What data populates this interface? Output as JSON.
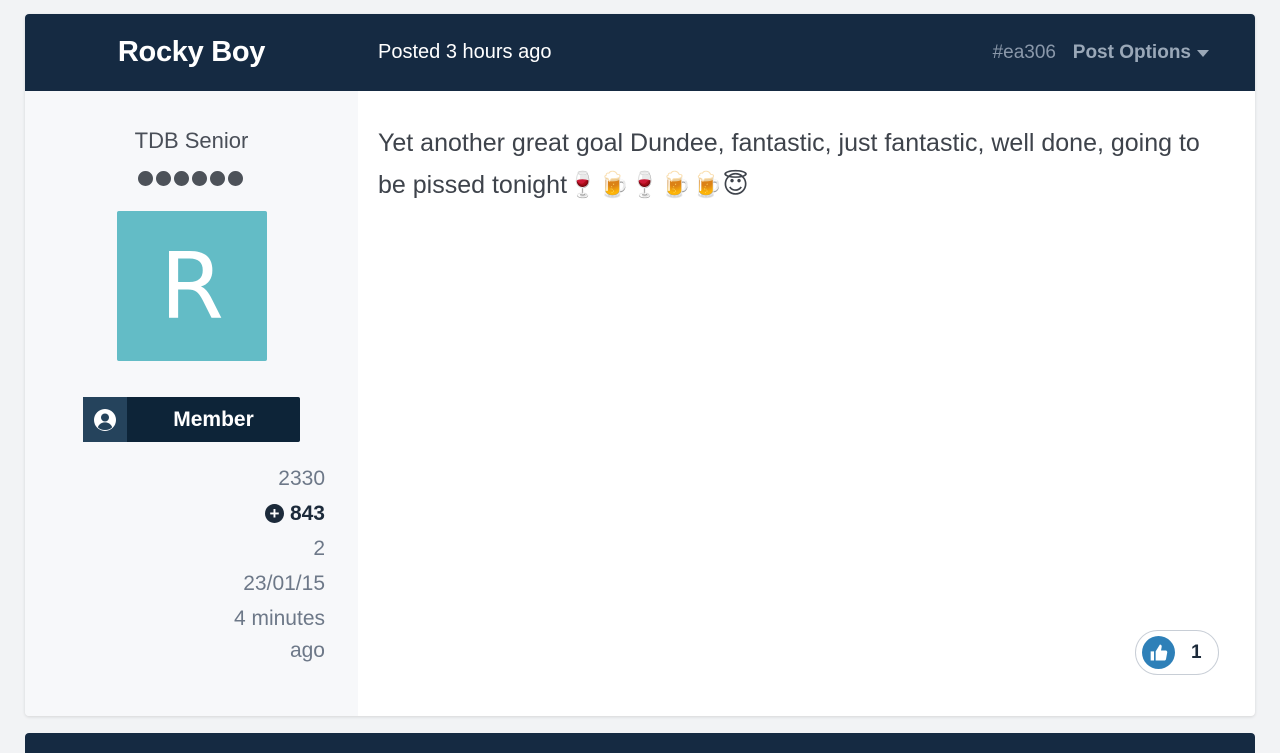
{
  "post": {
    "author": "Rocky Boy",
    "posted": "Posted 3 hours ago",
    "post_id": "#ea306",
    "options_label": "Post Options",
    "body": "Yet another great goal Dundee, fantastic, just fantastic, well done, going to be pissed tonight🍷🍺🍷🍺🍺😇"
  },
  "author_panel": {
    "member_title": "TDB Senior",
    "rank_pips": 6,
    "avatar_letter": "R",
    "avatar_color": "#63bcc6",
    "group": "Member",
    "posts": "2330",
    "reputation": "843",
    "stat_3": "2",
    "joined": "23/01/15",
    "last_visit_line1": "4 minutes",
    "last_visit_line2": "ago"
  },
  "reaction": {
    "icon": "thumbs-up-icon",
    "count": "1"
  },
  "colors": {
    "header": "#152a42",
    "badge": "#0d2438",
    "like": "#2e80b8"
  }
}
